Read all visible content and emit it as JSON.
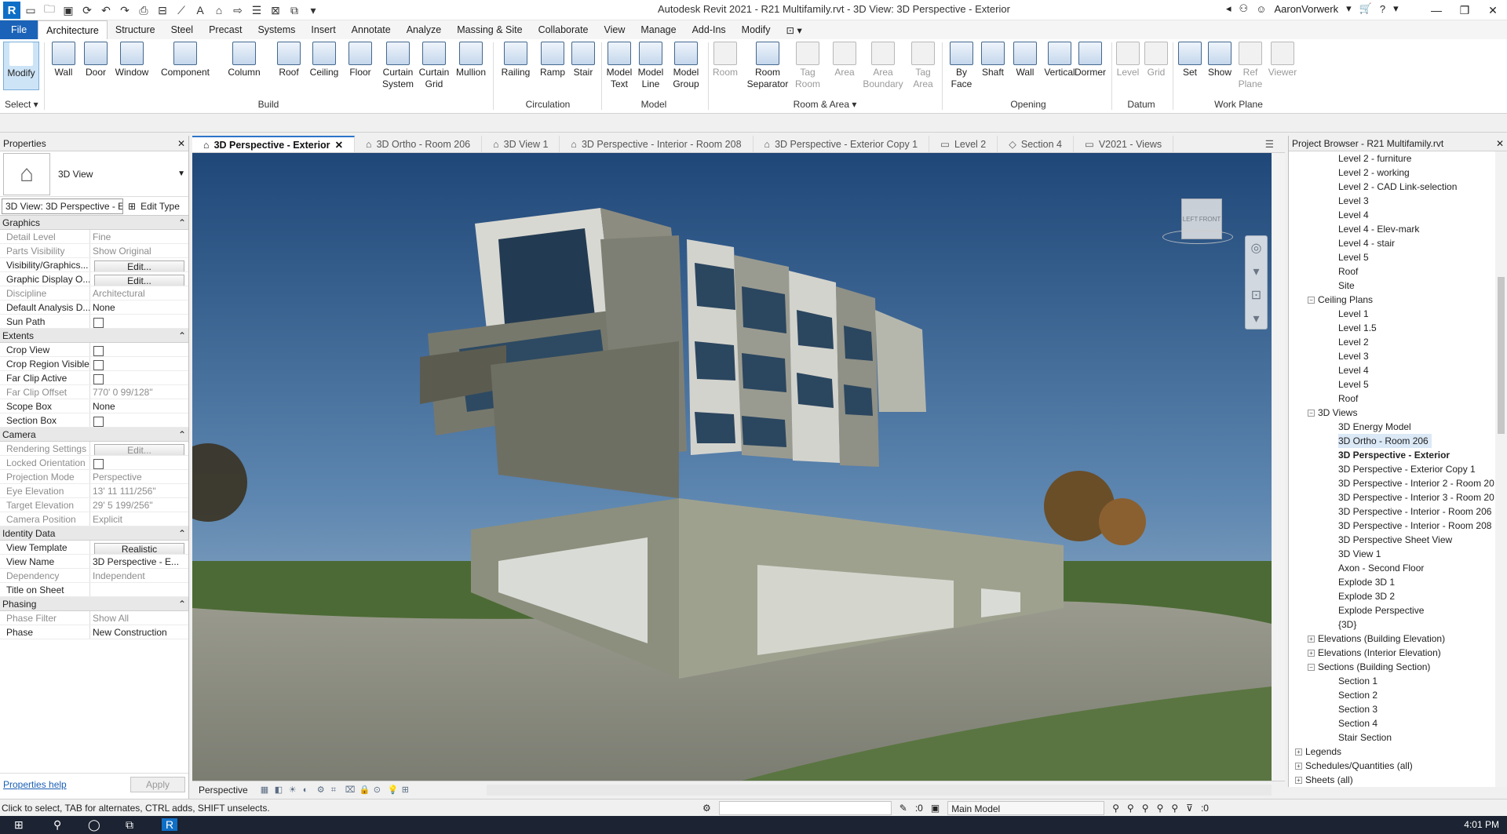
{
  "title_bar": {
    "title": "Autodesk Revit 2021 - R21 Multifamily.rvt - 3D View: 3D Perspective - Exterior",
    "user": "AaronVorwerk",
    "app_letter": "R"
  },
  "ribbon_tabs": [
    "File",
    "Architecture",
    "Structure",
    "Steel",
    "Precast",
    "Systems",
    "Insert",
    "Annotate",
    "Analyze",
    "Massing & Site",
    "Collaborate",
    "View",
    "Manage",
    "Add-Ins",
    "Modify"
  ],
  "ribbon": {
    "modify": "Modify",
    "select": "Select ▾",
    "build": {
      "wall": "Wall",
      "door": "Door",
      "window": "Window",
      "component": "Component",
      "column": "Column",
      "roof": "Roof",
      "ceiling": "Ceiling",
      "floor": "Floor",
      "curtain_system_1": "Curtain",
      "curtain_system_2": "System",
      "curtain_grid_1": "Curtain",
      "curtain_grid_2": "Grid",
      "mullion": "Mullion",
      "label": "Build"
    },
    "circulation": {
      "railing": "Railing",
      "ramp": "Ramp",
      "stair": "Stair",
      "label": "Circulation"
    },
    "model": {
      "text_1": "Model",
      "text_2": "Text",
      "line_1": "Model",
      "line_2": "Line",
      "group_1": "Model",
      "group_2": "Group",
      "label": "Model"
    },
    "room_area": {
      "room": "Room",
      "separator_1": "Room",
      "separator_2": "Separator",
      "tag_room_1": "Tag",
      "tag_room_2": "Room",
      "area": "Area",
      "boundary_1": "Area",
      "boundary_2": "Boundary",
      "tag_area_1": "Tag",
      "tag_area_2": "Area",
      "label": "Room & Area ▾"
    },
    "opening": {
      "by_face_1": "By",
      "by_face_2": "Face",
      "shaft": "Shaft",
      "wall": "Wall",
      "vertical": "Vertical",
      "dormer": "Dormer",
      "label": "Opening"
    },
    "datum": {
      "level": "Level",
      "grid": "Grid",
      "label": "Datum"
    },
    "work_plane": {
      "set": "Set",
      "show": "Show",
      "ref_plane_1": "Ref",
      "ref_plane_2": "Plane",
      "viewer": "Viewer",
      "label": "Work Plane"
    }
  },
  "properties": {
    "header": "Properties",
    "type_name": "3D View",
    "instance": "3D View: 3D Perspective - Exterior",
    "edit_type": "Edit Type",
    "groups": [
      {
        "name": "Graphics",
        "rows": [
          {
            "k": "Detail Level",
            "v": "Fine",
            "ro": true
          },
          {
            "k": "Parts Visibility",
            "v": "Show Original",
            "ro": true
          },
          {
            "k": "Visibility/Graphics...",
            "v": "Edit...",
            "btn": true
          },
          {
            "k": "Graphic Display O...",
            "v": "Edit...",
            "btn": true
          },
          {
            "k": "Discipline",
            "v": "Architectural",
            "ro": true
          },
          {
            "k": "Default Analysis D...",
            "v": "None"
          },
          {
            "k": "Sun Path",
            "chk": true
          }
        ]
      },
      {
        "name": "Extents",
        "rows": [
          {
            "k": "Crop View",
            "chk": true
          },
          {
            "k": "Crop Region Visible",
            "chk": true
          },
          {
            "k": "Far Clip Active",
            "chk": true
          },
          {
            "k": "Far Clip Offset",
            "v": "770'  0 99/128\"",
            "ro": true
          },
          {
            "k": "Scope Box",
            "v": "None"
          },
          {
            "k": "Section Box",
            "chk": true
          }
        ]
      },
      {
        "name": "Camera",
        "rows": [
          {
            "k": "Rendering Settings",
            "v": "Edit...",
            "btn": true,
            "ro": true
          },
          {
            "k": "Locked Orientation",
            "chk": true,
            "ro": true
          },
          {
            "k": "Projection Mode",
            "v": "Perspective",
            "ro": true
          },
          {
            "k": "Eye Elevation",
            "v": "13'  11 111/256\"",
            "ro": true
          },
          {
            "k": "Target Elevation",
            "v": "29'  5 199/256\"",
            "ro": true
          },
          {
            "k": "Camera Position",
            "v": "Explicit",
            "ro": true
          }
        ]
      },
      {
        "name": "Identity Data",
        "rows": [
          {
            "k": "View Template",
            "v": "Realistic",
            "btn": true
          },
          {
            "k": "View Name",
            "v": "3D Perspective - E..."
          },
          {
            "k": "Dependency",
            "v": "Independent",
            "ro": true
          },
          {
            "k": "Title on Sheet",
            "v": ""
          }
        ]
      },
      {
        "name": "Phasing",
        "rows": [
          {
            "k": "Phase Filter",
            "v": "Show All",
            "ro": true
          },
          {
            "k": "Phase",
            "v": "New Construction"
          }
        ]
      }
    ],
    "help": "Properties help",
    "apply": "Apply"
  },
  "view_tabs": [
    "3D Perspective - Exterior",
    "3D Ortho - Room 206",
    "3D View 1",
    "3D Perspective - Interior - Room 208",
    "3D Perspective - Exterior Copy 1",
    "Level 2",
    "Section 4",
    "V2021 - Views"
  ],
  "viewcube": {
    "left": "LEFT",
    "front": "FRONT"
  },
  "view_control": {
    "label": "Perspective"
  },
  "browser": {
    "header": "Project Browser - R21 Multifamily.rvt",
    "items": [
      {
        "t": "Level 2 - furniture",
        "l": 2
      },
      {
        "t": "Level 2 - working",
        "l": 2
      },
      {
        "t": "Level 2 - CAD Link-selection",
        "l": 2
      },
      {
        "t": "Level 3",
        "l": 2
      },
      {
        "t": "Level 4",
        "l": 2
      },
      {
        "t": "Level 4 - Elev-mark",
        "l": 2
      },
      {
        "t": "Level 4 - stair",
        "l": 2
      },
      {
        "t": "Level 5",
        "l": 2
      },
      {
        "t": "Roof",
        "l": 2
      },
      {
        "t": "Site",
        "l": 2
      },
      {
        "t": "Ceiling Plans",
        "l": 1,
        "exp": "−"
      },
      {
        "t": "Level 1",
        "l": 2
      },
      {
        "t": "Level 1.5",
        "l": 2
      },
      {
        "t": "Level 2",
        "l": 2
      },
      {
        "t": "Level 3",
        "l": 2
      },
      {
        "t": "Level 4",
        "l": 2
      },
      {
        "t": "Level 5",
        "l": 2
      },
      {
        "t": "Roof",
        "l": 2
      },
      {
        "t": "3D Views",
        "l": 1,
        "exp": "−"
      },
      {
        "t": "3D Energy Model",
        "l": 2
      },
      {
        "t": "3D Ortho - Room 206",
        "l": 2,
        "sel": true
      },
      {
        "t": "3D Perspective - Exterior",
        "l": 2,
        "bold": true
      },
      {
        "t": "3D Perspective - Exterior Copy 1",
        "l": 2
      },
      {
        "t": "3D Perspective - Interior 2 - Room 20",
        "l": 2
      },
      {
        "t": "3D Perspective - Interior 3 - Room 20",
        "l": 2
      },
      {
        "t": "3D Perspective - Interior - Room 206",
        "l": 2
      },
      {
        "t": "3D Perspective - Interior - Room 208",
        "l": 2
      },
      {
        "t": "3D Perspective Sheet View",
        "l": 2
      },
      {
        "t": "3D View 1",
        "l": 2
      },
      {
        "t": "Axon - Second Floor",
        "l": 2
      },
      {
        "t": "Explode 3D 1",
        "l": 2
      },
      {
        "t": "Explode 3D 2",
        "l": 2
      },
      {
        "t": "Explode Perspective",
        "l": 2
      },
      {
        "t": "{3D}",
        "l": 2
      },
      {
        "t": "Elevations (Building Elevation)",
        "l": 1,
        "exp": "+"
      },
      {
        "t": "Elevations (Interior Elevation)",
        "l": 1,
        "exp": "+"
      },
      {
        "t": "Sections (Building Section)",
        "l": 1,
        "exp": "−"
      },
      {
        "t": "Section 1",
        "l": 2
      },
      {
        "t": "Section 2",
        "l": 2
      },
      {
        "t": "Section 3",
        "l": 2
      },
      {
        "t": "Section 4",
        "l": 2
      },
      {
        "t": "Stair Section",
        "l": 2
      },
      {
        "t": "Legends",
        "l": 0,
        "exp": "+"
      },
      {
        "t": "Schedules/Quantities (all)",
        "l": 0,
        "exp": "+"
      },
      {
        "t": "Sheets (all)",
        "l": 0,
        "exp": "+"
      }
    ]
  },
  "status": {
    "text": "Click to select, TAB for alternates, CTRL adds, SHIFT unselects.",
    "count": ":0",
    "model": "Main Model",
    "filter": ":0"
  },
  "taskbar": {
    "time": "4:01 PM"
  }
}
